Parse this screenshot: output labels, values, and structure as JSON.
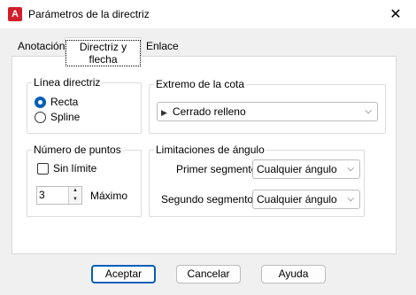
{
  "window": {
    "title": "Parámetros de la directriz",
    "app_icon_text": "A",
    "close_glyph": "✕"
  },
  "tabs": [
    {
      "label": "Anotación"
    },
    {
      "label": "Directriz y flecha",
      "selected": true
    },
    {
      "label": "Enlace"
    }
  ],
  "leader_line": {
    "title": "Línea directriz",
    "options": [
      {
        "label": "Recta",
        "selected": true
      },
      {
        "label": "Spline",
        "selected": false
      }
    ]
  },
  "arrowhead": {
    "title": "Extremo de la cota",
    "value": "Cerrado relleno",
    "value_icon": "closed-filled-arrow-icon"
  },
  "num_points": {
    "title": "Número de puntos",
    "no_limit_label": "Sin límite",
    "no_limit_checked": false,
    "value": "3",
    "max_label": "Máximo"
  },
  "angle_constraints": {
    "title": "Limitaciones de ángulo",
    "first_label": "Primer segmento:",
    "first_value": "Cualquier ángulo",
    "second_label": "Segundo segmento:",
    "second_value": "Cualquier ángulo"
  },
  "buttons": {
    "ok": "Aceptar",
    "cancel": "Cancelar",
    "help": "Ayuda"
  },
  "colors": {
    "accent": "#005fb8",
    "app_icon": "#d21e2b"
  }
}
